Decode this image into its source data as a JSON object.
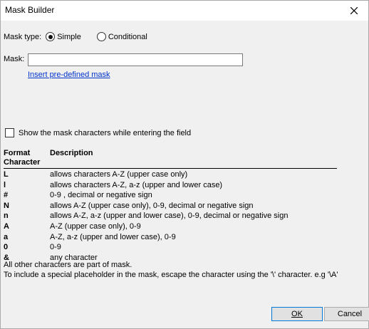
{
  "window": {
    "title": "Mask Builder"
  },
  "mask_type": {
    "label": "Mask type:",
    "options": [
      {
        "label": "Simple",
        "checked": true
      },
      {
        "label": "Conditional",
        "checked": false
      }
    ]
  },
  "mask": {
    "label": "Mask:",
    "value": ""
  },
  "insert_link": "Insert pre-defined mask",
  "show_chars": {
    "label": "Show the mask characters while entering the field",
    "checked": false
  },
  "table": {
    "headers": {
      "format": "Format Character",
      "description": "Description"
    },
    "rows": [
      {
        "ch": "L",
        "desc": "allows characters A-Z (upper case only)"
      },
      {
        "ch": "l",
        "desc": "allows characters A-Z, a-z (upper and lower case)"
      },
      {
        "ch": "#",
        "desc": "0-9 , decimal or negative sign"
      },
      {
        "ch": "N",
        "desc": "allows A-Z (upper case only), 0-9, decimal or negative sign"
      },
      {
        "ch": "n",
        "desc": "allows A-Z, a-z (upper and lower case), 0-9, decimal or negative sign"
      },
      {
        "ch": "A",
        "desc": "A-Z (upper case only), 0-9"
      },
      {
        "ch": "a",
        "desc": "A-Z, a-z (upper and lower case), 0-9"
      },
      {
        "ch": "0",
        "desc": "0-9"
      },
      {
        "ch": "&",
        "desc": "any character"
      }
    ]
  },
  "notes": [
    "All other characters are part of mask.",
    "To include a special placeholder in the mask, escape the character using the '\\' character. e.g '\\A'"
  ],
  "buttons": {
    "ok": "OK",
    "cancel": "Cancel"
  }
}
